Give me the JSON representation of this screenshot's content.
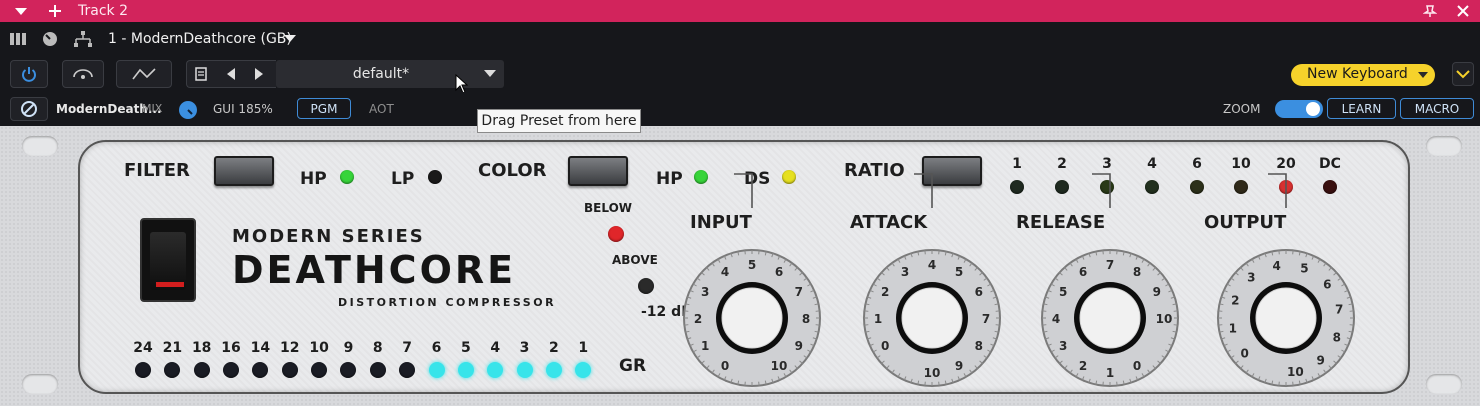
{
  "titlebar": {
    "title": "Track 2"
  },
  "toolbar": {
    "track_selector": "1 - ModernDeathcore (GB)"
  },
  "preset": {
    "name": "default*",
    "tooltip": "Drag Preset from here"
  },
  "keyboard": {
    "label": "New Keyboard"
  },
  "row4": {
    "plugin_name": "ModernDeath...",
    "mix": "MIX",
    "gui": "GUI 185%",
    "pgm": "PGM",
    "aot": "AOT",
    "zoom": "ZOOM",
    "learn": "LEARN",
    "macro": "MACRO"
  },
  "plugin": {
    "filter_label": "FILTER",
    "filter_hp": "HP",
    "filter_lp": "LP",
    "color_label": "COLOR",
    "color_hp": "HP",
    "color_ds": "DS",
    "ratio_label": "RATIO",
    "ratio_values": [
      "1",
      "2",
      "3",
      "4",
      "6",
      "10",
      "20",
      "DC"
    ],
    "below": "BELOW",
    "above": "ABOVE",
    "threshold": "-12 dB",
    "gr_label": "GR",
    "gr_scale": [
      "24",
      "21",
      "18",
      "16",
      "14",
      "12",
      "10",
      "9",
      "8",
      "7",
      "6",
      "5",
      "4",
      "3",
      "2",
      "1"
    ],
    "gr_lit_from_index": 10,
    "knobs": [
      {
        "label": "INPUT",
        "scale": [
          "0",
          "1",
          "2",
          "3",
          "4",
          "5",
          "6",
          "7",
          "8",
          "9",
          "10"
        ]
      },
      {
        "label": "ATTACK",
        "scale": [
          "0",
          "1",
          "2",
          "3",
          "4",
          "5",
          "6",
          "7",
          "8",
          "9",
          "10"
        ]
      },
      {
        "label": "RELEASE",
        "scale": [
          "0",
          "1",
          "2",
          "3",
          "4",
          "5",
          "6",
          "7",
          "8",
          "9",
          "10"
        ]
      },
      {
        "label": "OUTPUT",
        "scale": [
          "0",
          "1",
          "2",
          "3",
          "4",
          "5",
          "6",
          "7",
          "8",
          "9",
          "10"
        ]
      }
    ],
    "logo": {
      "line1": "MODERN SERIES",
      "line2": "DEATHCORE",
      "line3": "DISTORTION COMPRESSOR"
    }
  },
  "colors": {
    "titlebar": "#d2245c",
    "accent": "#3b8fe0",
    "keyboard": "#f6d22b",
    "led_green": "#37d43a",
    "led_yellow": "#e6e020",
    "led_red": "#e0262a",
    "led_cyan": "#37e4ea"
  }
}
